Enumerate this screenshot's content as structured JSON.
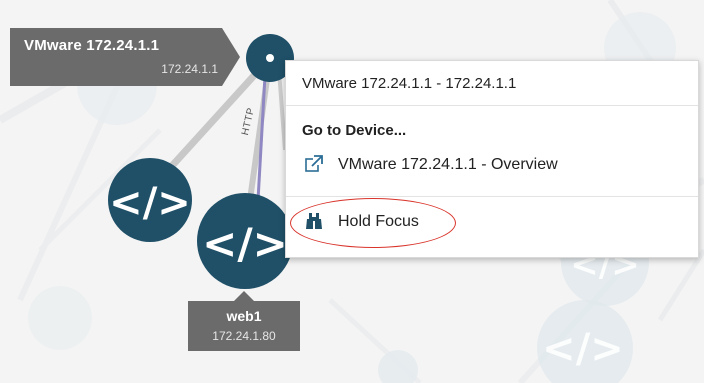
{
  "colors": {
    "node_fill": "#1f5068",
    "label_bg": "#6b6b6b",
    "link_gray": "#c8c8c8",
    "link_purple": "#8f88c2",
    "focus_ring": "#d9342b",
    "icon_blue": "#2b6d96"
  },
  "device_label": {
    "name": "VMware 172.24.1.1",
    "ip": "172.24.1.1"
  },
  "web_label": {
    "name": "web1",
    "ip": "172.24.1.80"
  },
  "link_label": "HTTP",
  "context_menu": {
    "title": "VMware 172.24.1.1 - 172.24.1.1",
    "section_heading": "Go to Device...",
    "items": [
      {
        "label": "VMware 172.24.1.1 - Overview",
        "icon": "external-link-icon"
      },
      {
        "label": "Hold Focus",
        "icon": "binoculars-icon"
      }
    ]
  }
}
